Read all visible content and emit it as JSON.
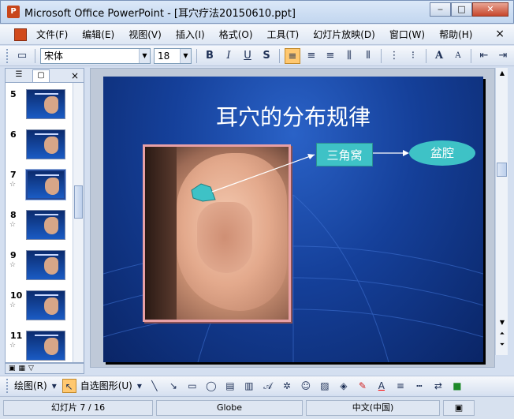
{
  "window": {
    "title": "Microsoft Office PowerPoint - [耳穴疗法20150610.ppt]",
    "controls": [
      "minimize",
      "maximize",
      "close"
    ]
  },
  "menubar": {
    "items": [
      "文件(F)",
      "编辑(E)",
      "视图(V)",
      "插入(I)",
      "格式(O)",
      "工具(T)",
      "幻灯片放映(D)",
      "窗口(W)",
      "帮助(H)"
    ],
    "close": "×"
  },
  "toolbar": {
    "font_name": "宋体",
    "font_size": "18",
    "bold": "B",
    "italic": "I",
    "underline": "U",
    "shadow": "S",
    "font_grow": "A",
    "font_shrink": "A"
  },
  "slides_pane": {
    "close": "×",
    "slides": [
      {
        "number": "5",
        "has_star": false,
        "selected": false
      },
      {
        "number": "6",
        "has_star": false,
        "selected": false
      },
      {
        "number": "7",
        "has_star": true,
        "selected": true
      },
      {
        "number": "8",
        "has_star": true,
        "selected": false
      },
      {
        "number": "9",
        "has_star": true,
        "selected": false
      },
      {
        "number": "10",
        "has_star": true,
        "selected": false
      },
      {
        "number": "11",
        "has_star": true,
        "selected": false
      }
    ],
    "star_glyph": "☆"
  },
  "slide": {
    "title": "耳穴的分布规律",
    "label_box": "三角窝",
    "label_oval": "盆腔"
  },
  "draw_toolbar": {
    "draw_menu": "绘图(R)",
    "autoshapes_menu": "自选图形(U)"
  },
  "statusbar": {
    "slide_pos": "幻灯片 7 / 16",
    "theme": "Globe",
    "language": "中文(中国)"
  },
  "colors": {
    "slide_bg": "#15409a",
    "shape_fill": "#3ec2c6",
    "active_button": "#ffc870"
  }
}
